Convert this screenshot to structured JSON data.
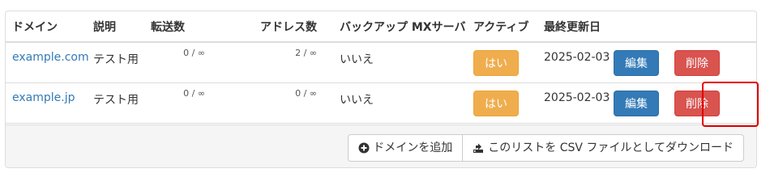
{
  "table": {
    "headers": {
      "domain": "ドメイン",
      "description": "説明",
      "transfers": "転送数",
      "addresses": "アドレス数",
      "backup_mx": "バックアップ MXサーバ",
      "active": "アクティブ",
      "last_updated": "最終更新日"
    },
    "rows": [
      {
        "domain": "example.com",
        "description": "テスト用",
        "transfers": "0 / ∞",
        "addresses": "2 / ∞",
        "backup_mx": "いいえ",
        "active": "はい",
        "last_updated": "2025-02-03",
        "edit_label": "編集",
        "delete_label": "削除"
      },
      {
        "domain": "example.jp",
        "description": "テスト用",
        "transfers": "0 / ∞",
        "addresses": "0 / ∞",
        "backup_mx": "いいえ",
        "active": "はい",
        "last_updated": "2025-02-03",
        "edit_label": "編集",
        "delete_label": "削除"
      }
    ]
  },
  "footer": {
    "add_domain_label": "ドメインを追加",
    "add_domain_icon": "plus-circle-icon",
    "export_csv_label": "このリストを CSV ファイルとしてダウンロード",
    "export_csv_icon": "export-icon"
  },
  "colors": {
    "link": "#337ab7",
    "active_button": "#f0ad4e",
    "edit_button": "#337ab7",
    "delete_button": "#d9534f",
    "highlight_box": "#e30000"
  }
}
